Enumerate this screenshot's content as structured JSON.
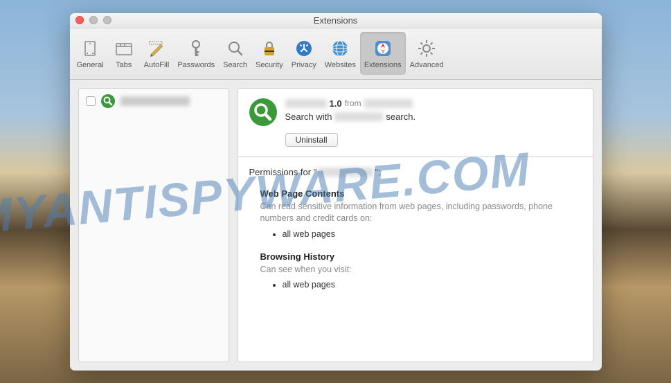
{
  "window": {
    "title": "Extensions"
  },
  "toolbar": {
    "items": [
      {
        "label": "General"
      },
      {
        "label": "Tabs"
      },
      {
        "label": "AutoFill"
      },
      {
        "label": "Passwords"
      },
      {
        "label": "Search"
      },
      {
        "label": "Security"
      },
      {
        "label": "Privacy"
      },
      {
        "label": "Websites"
      },
      {
        "label": "Extensions"
      },
      {
        "label": "Advanced"
      }
    ]
  },
  "extension": {
    "version": "1.0",
    "from_label": "from",
    "description_prefix": "Search with",
    "description_suffix": "search.",
    "uninstall_label": "Uninstall"
  },
  "permissions": {
    "title_prefix": "Permissions for \"",
    "title_suffix": "\":",
    "sections": [
      {
        "heading": "Web Page Contents",
        "desc": "Can read sensitive information from web pages, including passwords, phone numbers and credit cards on:",
        "items": [
          "all web pages"
        ]
      },
      {
        "heading": "Browsing History",
        "desc": "Can see when you visit:",
        "items": [
          "all web pages"
        ]
      }
    ]
  },
  "watermark": "MYANTISPYWARE.COM"
}
